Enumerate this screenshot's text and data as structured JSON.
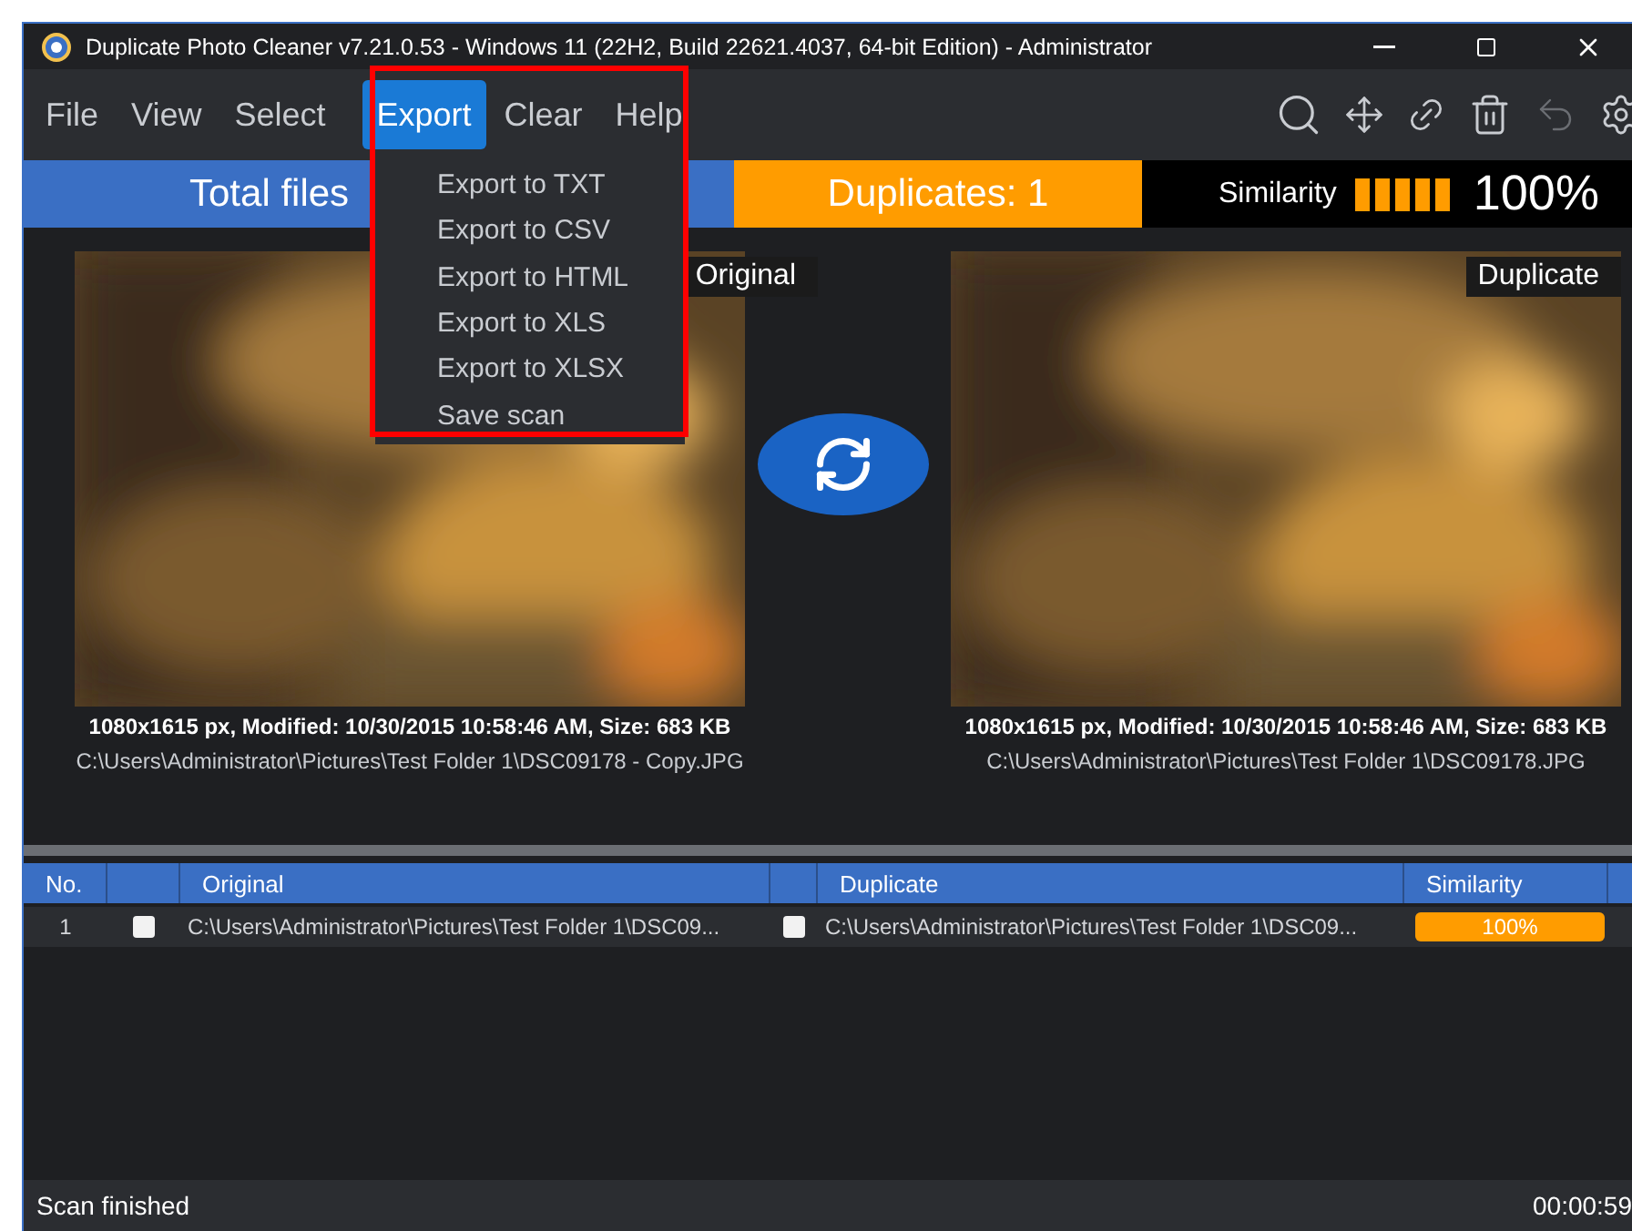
{
  "window": {
    "title": "Duplicate Photo Cleaner v7.21.0.53 - Windows 11 (22H2, Build 22621.4037, 64-bit Edition) - Administrator"
  },
  "menu": [
    {
      "label": "File",
      "selected": false
    },
    {
      "label": "View",
      "selected": false
    },
    {
      "label": "Select",
      "selected": false
    },
    {
      "label": "Export",
      "selected": true
    },
    {
      "label": "Clear",
      "selected": false
    },
    {
      "label": "Help",
      "selected": false
    }
  ],
  "export_menu": [
    "Export to TXT",
    "Export to CSV",
    "Export to HTML",
    "Export to XLS",
    "Export to XLSX",
    "Save scan"
  ],
  "stats": {
    "total_files": "Total files",
    "duplicates": "Duplicates: 1",
    "similarity_label": "Similarity",
    "level": 1,
    "similarity_value": "100%"
  },
  "photos": [
    {
      "badge": "Original",
      "info": "1080x1615 px, Modified: 10/30/2015 10:58:46 AM, Size: 683 KB",
      "path": "C:\\Users\\Administrator\\Pictures\\Test Folder 1\\DSC09178 - Copy.JPG"
    },
    {
      "badge": "Duplicate",
      "info": "1080x1615 px, Modified: 10/30/2015 10:58:46 AM, Size: 683 KB",
      "path": "C:\\Users\\Administrator\\Pictures\\Test Folder 1\\DSC09178.JPG"
    }
  ],
  "table": {
    "columns": [
      "No.",
      "Original",
      "Duplicate",
      "Similarity"
    ],
    "rows": [
      {
        "no": "1",
        "original_checked": false,
        "original": "C:\\Users\\Administrator\\Pictures\\Test Folder 1\\DSC09...",
        "duplicate_checked": false,
        "duplicate": "C:\\Users\\Administrator\\Pictures\\Test Folder 1\\DSC09...",
        "level": 1,
        "similarity": "100%"
      }
    ]
  },
  "status_bar": {
    "message": "Scan finished",
    "time": "00:00:59"
  }
}
